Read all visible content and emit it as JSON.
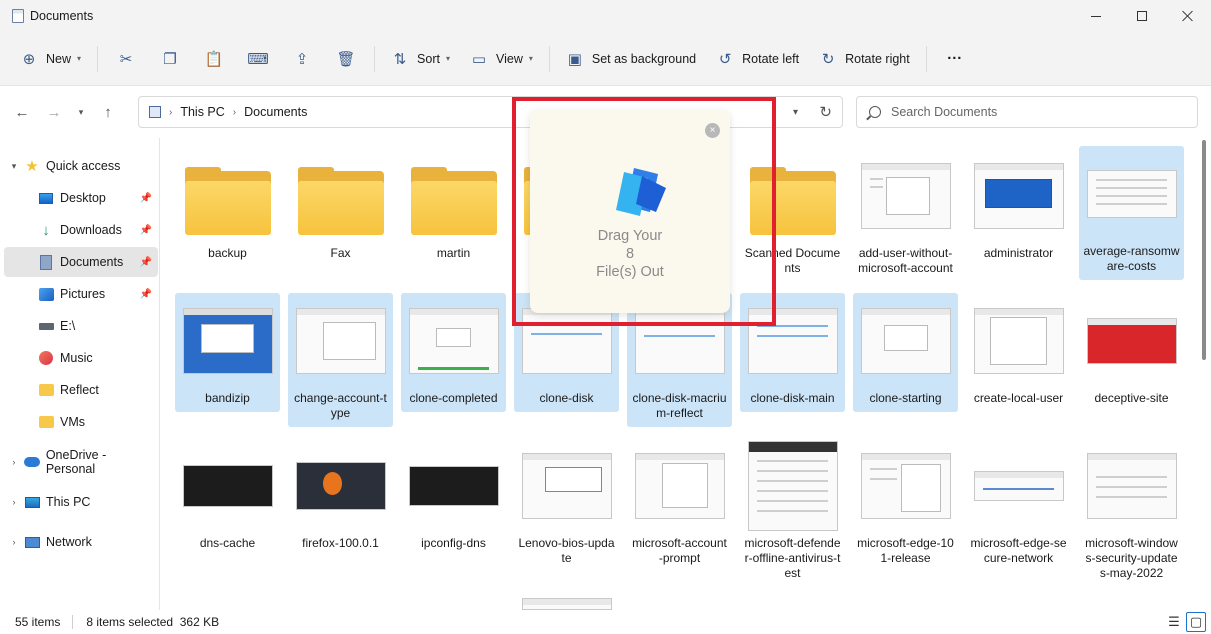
{
  "window": {
    "title": "Documents"
  },
  "commandbar": {
    "new_label": "New",
    "sort_label": "Sort",
    "view_label": "View",
    "set_background_label": "Set as background",
    "rotate_left_label": "Rotate left",
    "rotate_right_label": "Rotate right",
    "more_label": "···"
  },
  "address": {
    "crumbs": [
      "This PC",
      "Documents"
    ],
    "search_placeholder": "Search Documents"
  },
  "sidebar": {
    "items": [
      {
        "label": "Quick access",
        "icon": "star-icon"
      },
      {
        "label": "Desktop",
        "icon": "desktop-icon"
      },
      {
        "label": "Downloads",
        "icon": "download-icon"
      },
      {
        "label": "Documents",
        "icon": "documents-icon"
      },
      {
        "label": "Pictures",
        "icon": "pictures-icon"
      },
      {
        "label": "E:\\",
        "icon": "drive-icon"
      },
      {
        "label": "Music",
        "icon": "music-icon"
      },
      {
        "label": "Reflect",
        "icon": "folder-icon"
      },
      {
        "label": "VMs",
        "icon": "folder-icon"
      },
      {
        "label": "OneDrive - Personal",
        "icon": "cloud-icon"
      },
      {
        "label": "This PC",
        "icon": "computer-icon"
      },
      {
        "label": "Network",
        "icon": "network-icon"
      }
    ]
  },
  "files": {
    "row1": [
      {
        "name": "backup",
        "kind": "folder",
        "selected": false
      },
      {
        "name": "Fax",
        "kind": "folder",
        "selected": false
      },
      {
        "name": "martin",
        "kind": "folder",
        "selected": false
      },
      {
        "name": "",
        "kind": "folder",
        "selected": false
      },
      {
        "name": "",
        "kind": "folder",
        "selected": false
      },
      {
        "name": "Scanned Documents",
        "kind": "folder",
        "selected": false
      },
      {
        "name": "add-user-without-microsoft-account",
        "kind": "image",
        "selected": false
      },
      {
        "name": "administrator",
        "kind": "image",
        "selected": false
      },
      {
        "name": "average-ransomware-costs",
        "kind": "image",
        "selected": true
      }
    ],
    "row2": [
      {
        "name": "bandizip",
        "kind": "image",
        "selected": true
      },
      {
        "name": "change-account-type",
        "kind": "image",
        "selected": true
      },
      {
        "name": "clone-completed",
        "kind": "image",
        "selected": true
      },
      {
        "name": "clone-disk",
        "kind": "image",
        "selected": true
      },
      {
        "name": "clone-disk-macrium-reflect",
        "kind": "image",
        "selected": true
      },
      {
        "name": "clone-disk-main",
        "kind": "image",
        "selected": true
      },
      {
        "name": "clone-starting",
        "kind": "image",
        "selected": true
      },
      {
        "name": "create-local-user",
        "kind": "image",
        "selected": false
      },
      {
        "name": "deceptive-site",
        "kind": "image",
        "selected": false
      }
    ],
    "row3": [
      {
        "name": "dns-cache",
        "kind": "image",
        "selected": false
      },
      {
        "name": "firefox-100.0.1",
        "kind": "image",
        "selected": false
      },
      {
        "name": "ipconfig-dns",
        "kind": "image",
        "selected": false
      },
      {
        "name": "Lenovo-bios-update",
        "kind": "image",
        "selected": false
      },
      {
        "name": "microsoft-account-prompt",
        "kind": "image",
        "selected": false
      },
      {
        "name": "microsoft-defender-offline-antivirus-test",
        "kind": "image",
        "selected": false
      },
      {
        "name": "microsoft-edge-101-release",
        "kind": "image",
        "selected": false
      },
      {
        "name": "microsoft-edge-secure-network",
        "kind": "image",
        "selected": false
      },
      {
        "name": "microsoft-windows-security-updates-may-2022",
        "kind": "image",
        "selected": false
      }
    ]
  },
  "drag_popup": {
    "line1": "Drag Your",
    "line2": "8",
    "line3": "File(s) Out",
    "close_label": "×"
  },
  "status": {
    "items_count": "55 items",
    "selection": "8 items selected  362 KB"
  },
  "colors": {
    "selection": "#cce4f7",
    "highlight_frame": "#e0202e",
    "folder": "#f6c33d"
  }
}
